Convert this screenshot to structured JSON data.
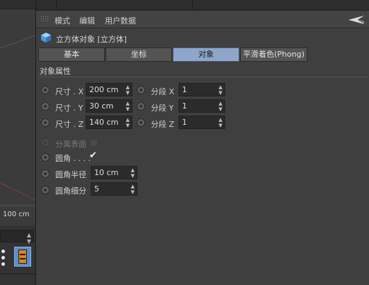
{
  "viewport": {
    "scale_label": "100 cm"
  },
  "menubar": {
    "items": [
      "模式",
      "编辑",
      "用户数据"
    ]
  },
  "object": {
    "title": "立方体对象 [立方体]"
  },
  "tabs": [
    {
      "label": "基本",
      "active": false
    },
    {
      "label": "坐标",
      "active": false
    },
    {
      "label": "对象",
      "active": true
    },
    {
      "label": "平滑着色(Phong)",
      "active": false
    }
  ],
  "section": {
    "title": "对象属性"
  },
  "size": [
    {
      "label": "尺寸 . X",
      "value": "200 cm"
    },
    {
      "label": "尺寸 . Y",
      "value": "30 cm"
    },
    {
      "label": "尺寸 . Z",
      "value": "140 cm"
    }
  ],
  "segments": [
    {
      "label": "分段 X",
      "value": "1"
    },
    {
      "label": "分段 Y",
      "value": "1"
    },
    {
      "label": "分段 Z",
      "value": "1"
    }
  ],
  "separate_surfaces": {
    "label": "分离表面",
    "checked": false
  },
  "fillet": {
    "label": "圆角 . . . .",
    "checked": true,
    "check_glyph": "✔"
  },
  "fillet_radius": {
    "label": "圆角半径",
    "value": "10 cm"
  },
  "fillet_subdivision": {
    "label": "圆角细分",
    "value": "5"
  },
  "spinner_glyph": "▲\n▼",
  "colors": {
    "active_tab": "#8ea6cc",
    "panel_bg": "#3f3f3f",
    "field_bg": "#2b2b2b"
  }
}
